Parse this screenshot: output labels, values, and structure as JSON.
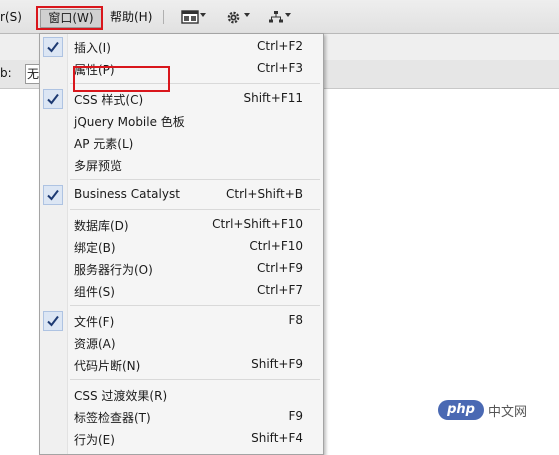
{
  "menubar": {
    "left_fragment": "r(S)",
    "window_label": "窗口(W)",
    "help_label": "帮助(H)"
  },
  "properties": {
    "label": "b:",
    "field_value": "无"
  },
  "window_menu": {
    "items": [
      {
        "label": "插入(I)",
        "shortcut": "Ctrl+F2",
        "checked": true
      },
      {
        "label": "属性(P)",
        "shortcut": "Ctrl+F3",
        "checked": false
      },
      {
        "label": "CSS 样式(C)",
        "shortcut": "Shift+F11",
        "checked": true
      },
      {
        "label": "jQuery Mobile 色板",
        "shortcut": "",
        "checked": false
      },
      {
        "label": "AP 元素(L)",
        "shortcut": "",
        "checked": false
      },
      {
        "label": "多屏预览",
        "shortcut": "",
        "checked": false
      },
      {
        "label": "Business Catalyst",
        "shortcut": "Ctrl+Shift+B",
        "checked": true
      },
      {
        "label": "数据库(D)",
        "shortcut": "Ctrl+Shift+F10",
        "checked": false
      },
      {
        "label": "绑定(B)",
        "shortcut": "Ctrl+F10",
        "checked": false
      },
      {
        "label": "服务器行为(O)",
        "shortcut": "Ctrl+F9",
        "checked": false
      },
      {
        "label": "组件(S)",
        "shortcut": "Ctrl+F7",
        "checked": false
      },
      {
        "label": "文件(F)",
        "shortcut": "F8",
        "checked": true
      },
      {
        "label": "资源(A)",
        "shortcut": "",
        "checked": false
      },
      {
        "label": "代码片断(N)",
        "shortcut": "Shift+F9",
        "checked": false
      },
      {
        "label": "CSS 过渡效果(R)",
        "shortcut": "",
        "checked": false
      },
      {
        "label": "标签检查器(T)",
        "shortcut": "F9",
        "checked": false
      },
      {
        "label": "行为(E)",
        "shortcut": "Shift+F4",
        "checked": false
      }
    ]
  },
  "watermark": {
    "logo_text": "php",
    "site_text": "中文网"
  },
  "colors": {
    "highlight": "#d9161c",
    "check_bg": "#dce6f4",
    "menu_bg": "#f5f5f5",
    "watermark_blue": "#4a69b3"
  }
}
